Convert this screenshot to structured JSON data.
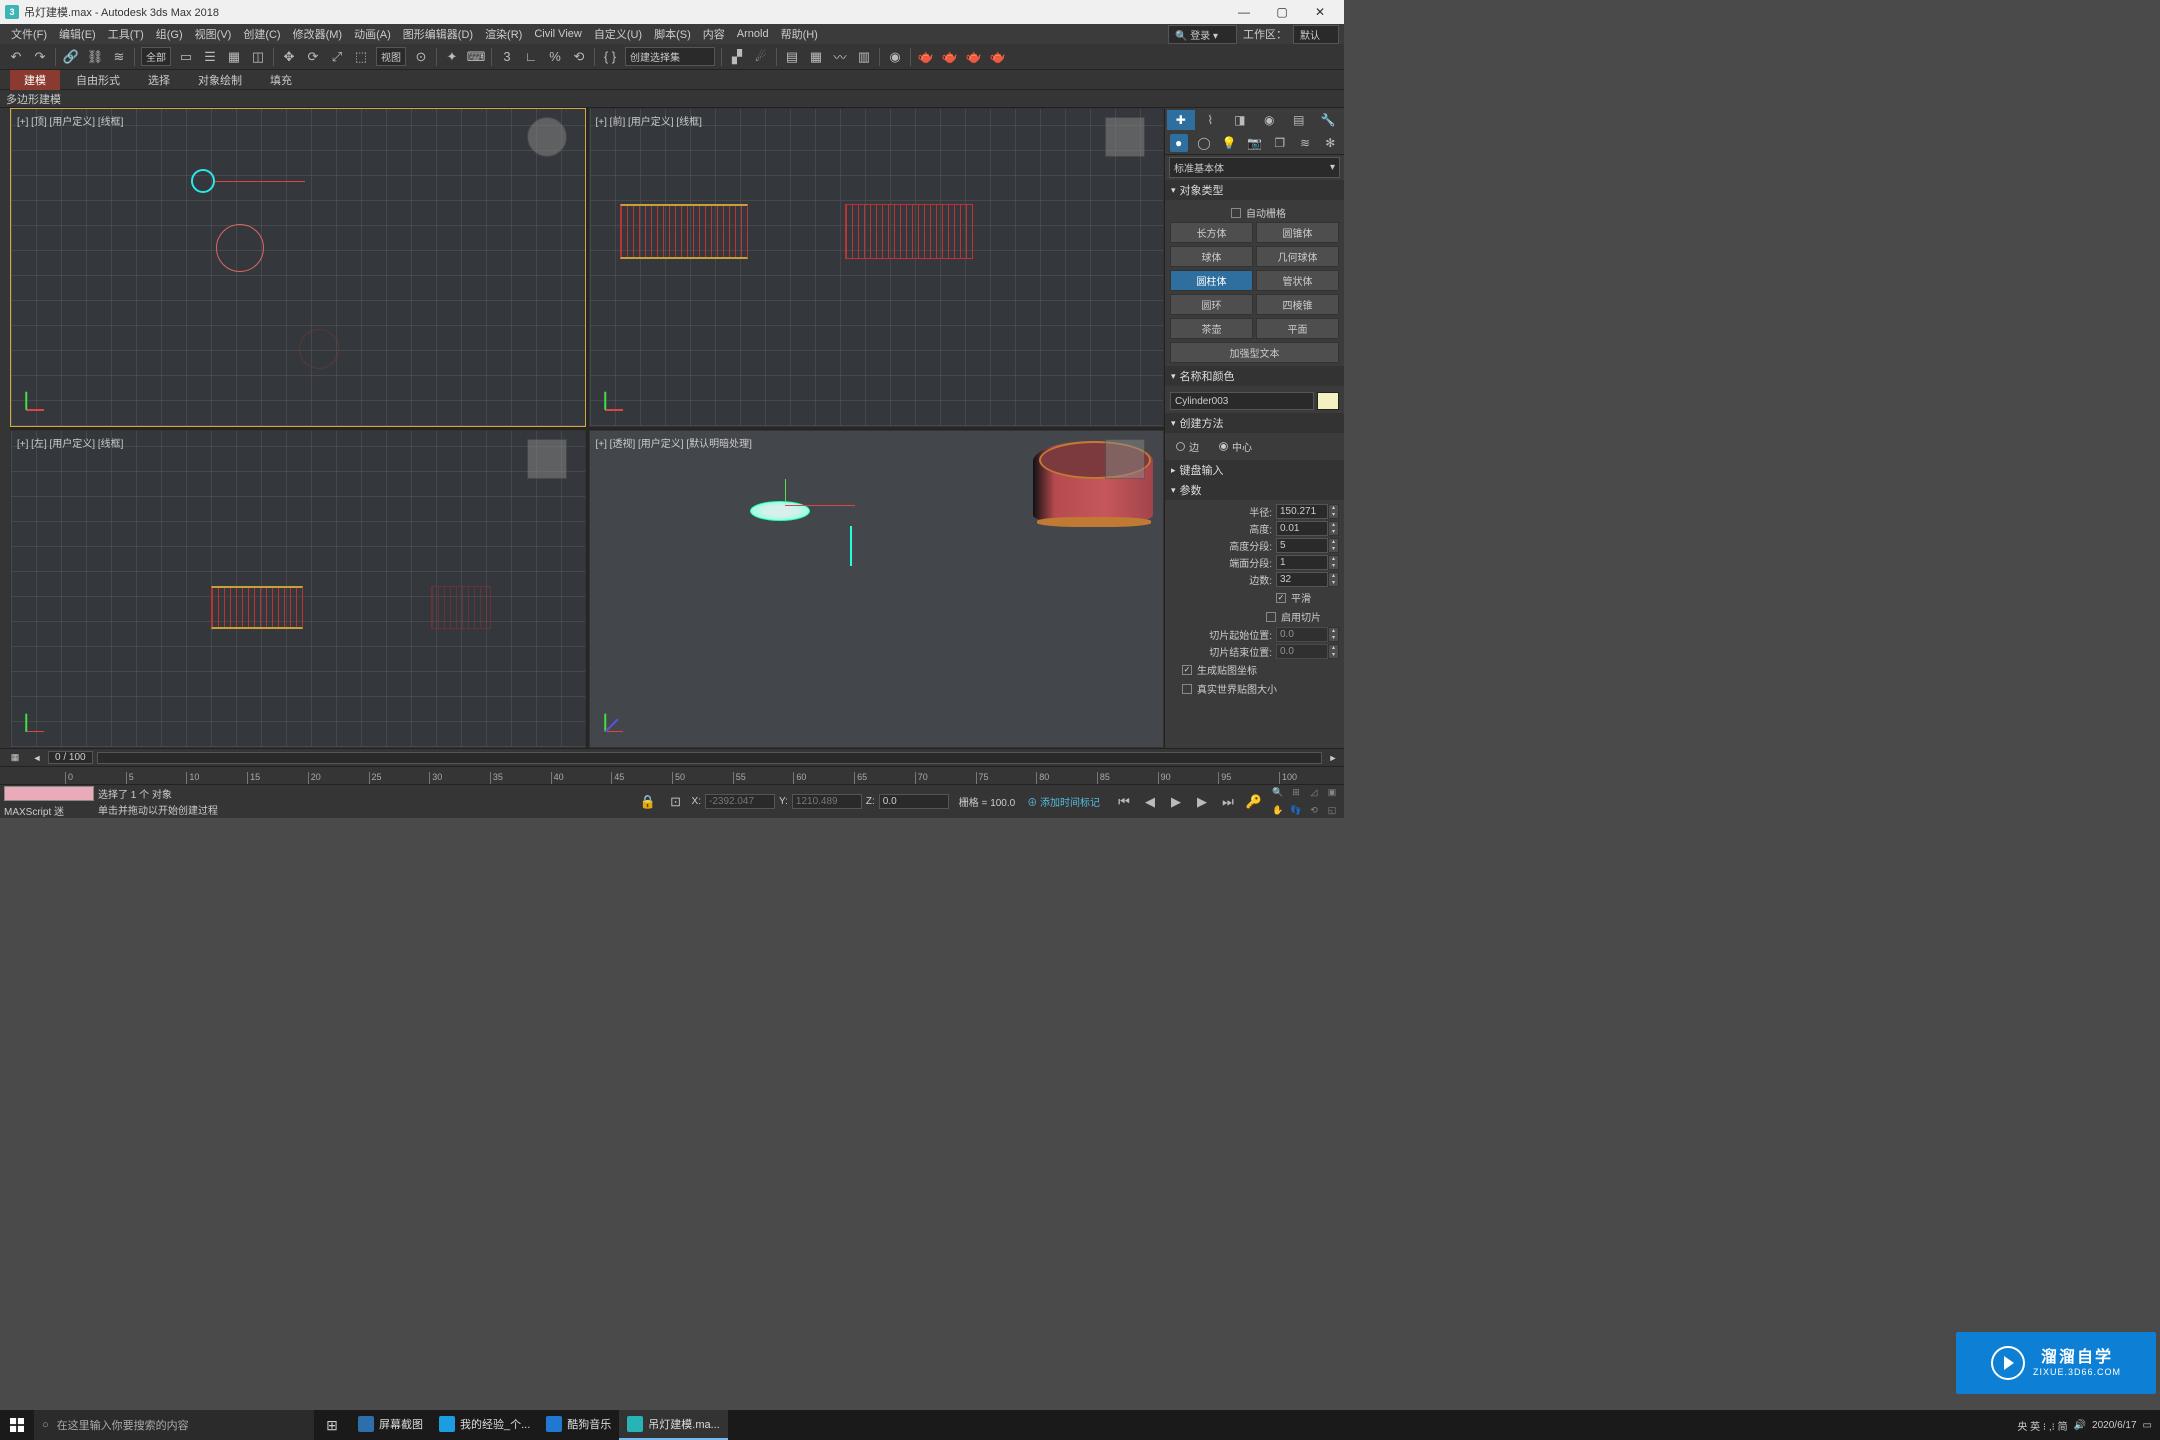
{
  "title": "吊灯建模.max - Autodesk 3ds Max 2018",
  "menus": [
    "文件(F)",
    "编辑(E)",
    "工具(T)",
    "组(G)",
    "视图(V)",
    "创建(C)",
    "修改器(M)",
    "动画(A)",
    "图形编辑器(D)",
    "渲染(R)",
    "Civil View",
    "自定义(U)",
    "脚本(S)",
    "内容",
    "Arnold",
    "帮助(H)"
  ],
  "workspace": {
    "search_placeholder": "登录",
    "label": "工作区：",
    "value": "默认"
  },
  "toolbar_select_drop": "全部",
  "toolbar_view_drop": "视图",
  "ribbon_tabs": {
    "active": "建模",
    "items": [
      "自由形式",
      "选择",
      "对象绘制",
      "填充"
    ]
  },
  "poly_label": "多边形建模",
  "selection_set_placeholder": "创建选择集",
  "viewports": {
    "top": "[+] [顶] [用户定义] [线框]",
    "front": "[+] [前] [用户定义] [线框]",
    "left": "[+] [左] [用户定义] [线框]",
    "persp": "[+] [透视] [用户定义] [默认明暗处理]"
  },
  "panel": {
    "primitive_drop": "标准基本体",
    "obj_type_hdr": "对象类型",
    "auto_grid": "自动栅格",
    "buttons": [
      "长方体",
      "圆锥体",
      "球体",
      "几何球体",
      "圆柱体",
      "管状体",
      "圆环",
      "四棱锥",
      "茶壶",
      "平面",
      "加强型文本"
    ],
    "name_hdr": "名称和颜色",
    "name_value": "Cylinder003",
    "create_hdr": "创建方法",
    "create_edge": "边",
    "create_center": "中心",
    "kb_hdr": "键盘输入",
    "params_hdr": "参数",
    "radius_l": "半径:",
    "radius_v": "150.271",
    "height_l": "高度:",
    "height_v": "0.01",
    "hseg_l": "高度分段:",
    "hseg_v": "5",
    "cseg_l": "端面分段:",
    "cseg_v": "1",
    "sides_l": "边数:",
    "sides_v": "32",
    "smooth": "平滑",
    "slice": "启用切片",
    "slicefrom_l": "切片起始位置:",
    "slicefrom_v": "0.0",
    "sliceto_l": "切片结束位置:",
    "sliceto_v": "0.0",
    "genmap": "生成贴图坐标",
    "realworld": "真实世界贴图大小"
  },
  "timeline": {
    "pos": "0 / 100",
    "ticks": [
      0,
      5,
      10,
      15,
      20,
      25,
      30,
      35,
      40,
      45,
      50,
      55,
      60,
      65,
      70,
      75,
      80,
      85,
      90,
      95,
      100
    ]
  },
  "status": {
    "sel": "选择了 1 个 对象",
    "hint": "单击并拖动以开始创建过程",
    "maxscript": "MAXScript  迷",
    "x": "-2392.047",
    "y": "1210.489",
    "z": "0.0",
    "grid_l": "栅格 =",
    "grid_v": "100.0",
    "addtime": "添加时间标记",
    "coord_x_label": "X:",
    "coord_y_label": "Y:",
    "coord_z_label": "Z:"
  },
  "watermark": {
    "cn": "溜溜自学",
    "en": "ZIXUE.3D66.COM"
  },
  "taskbar": {
    "search": "在这里输入你要搜索的内容",
    "apps": [
      {
        "icon_bg": "#2d6fab",
        "label": "屏幕截图"
      },
      {
        "icon_bg": "#1b9de0",
        "label": "我的经验_个..."
      },
      {
        "icon_bg": "#1f78d1",
        "label": "酷狗音乐"
      },
      {
        "icon_bg": "#28b3b5",
        "label": "吊灯建模.ma..."
      }
    ],
    "tray": {
      "ime": "央 英 ⁝ ,⁝ 简",
      "date": "2020/6/17"
    }
  }
}
